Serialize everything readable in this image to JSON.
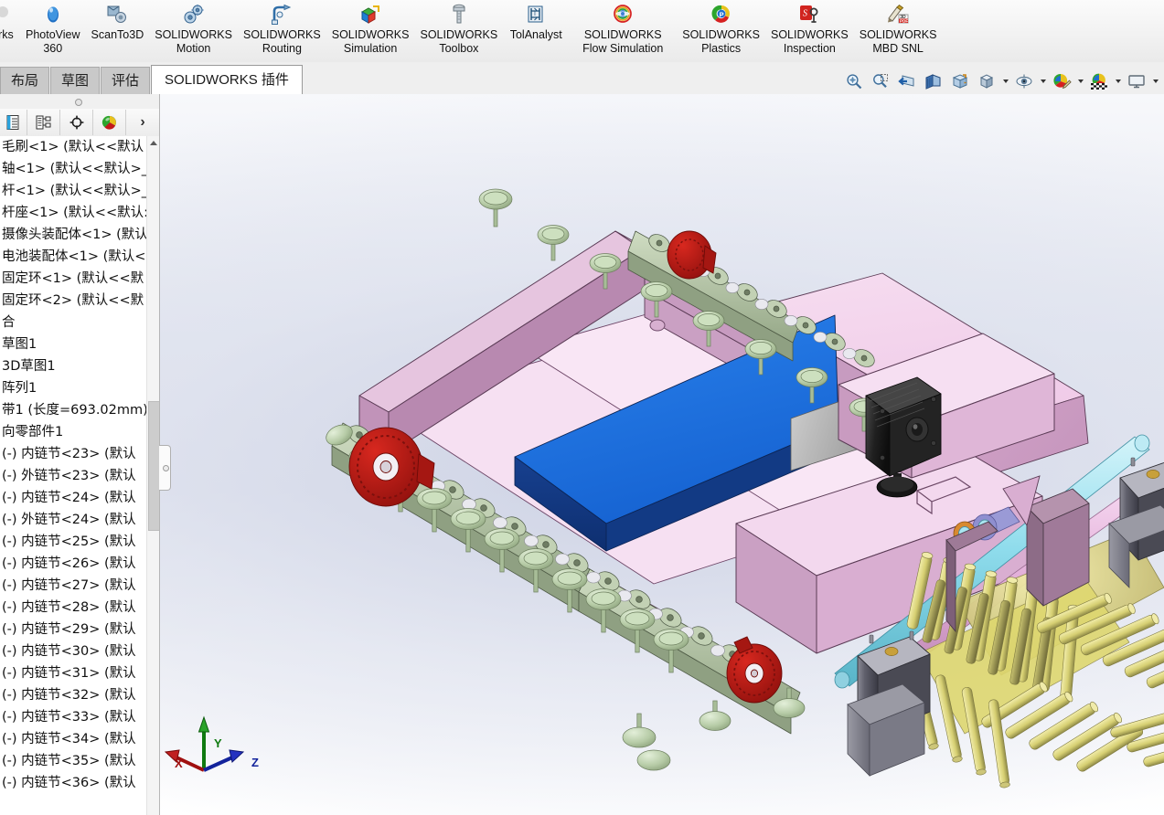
{
  "app": {
    "name": "SOLIDWORKS",
    "document_type": "assembly"
  },
  "ribbon": {
    "items": [
      {
        "label": "orks",
        "icon": "solidworks-partial-icon",
        "truncated": true
      },
      {
        "label": "PhotoView\n360",
        "icon": "photoview-360-icon"
      },
      {
        "label": "ScanTo3D",
        "icon": "scanto3d-icon"
      },
      {
        "label": "SOLIDWORKS\nMotion",
        "icon": "solidworks-motion-icon"
      },
      {
        "label": "SOLIDWORKS\nRouting",
        "icon": "solidworks-routing-icon"
      },
      {
        "label": "SOLIDWORKS\nSimulation",
        "icon": "solidworks-simulation-icon"
      },
      {
        "label": "SOLIDWORKS\nToolbox",
        "icon": "solidworks-toolbox-icon"
      },
      {
        "label": "TolAnalyst",
        "icon": "tolanalyst-icon"
      },
      {
        "label": "SOLIDWORKS\nFlow Simulation",
        "icon": "solidworks-flow-simulation-icon"
      },
      {
        "label": "SOLIDWORKS\nPlastics",
        "icon": "solidworks-plastics-icon"
      },
      {
        "label": "SOLIDWORKS\nInspection",
        "icon": "solidworks-inspection-icon"
      },
      {
        "label": "SOLIDWORKS\nMBD SNL",
        "icon": "solidworks-mbd-snl-icon"
      }
    ]
  },
  "feature_tabs": [
    {
      "label": "布局",
      "active": false,
      "name": "tab-layout"
    },
    {
      "label": "草图",
      "active": false,
      "name": "tab-sketch"
    },
    {
      "label": "评估",
      "active": false,
      "name": "tab-evaluate"
    },
    {
      "label": "SOLIDWORKS 插件",
      "active": true,
      "name": "tab-solidworks-addins"
    }
  ],
  "view_toolbar": [
    {
      "name": "zoom-to-fit-icon",
      "caret": false
    },
    {
      "name": "zoom-to-area-icon",
      "caret": false
    },
    {
      "name": "previous-view-icon",
      "caret": false
    },
    {
      "name": "section-view-icon",
      "caret": false
    },
    {
      "name": "view-orientation-icon",
      "caret": false
    },
    {
      "name": "display-style-icon",
      "caret": true
    },
    {
      "name": "hide-show-items-icon",
      "caret": true
    },
    {
      "name": "edit-appearance-icon",
      "caret": true
    },
    {
      "name": "apply-scene-icon",
      "caret": true
    },
    {
      "name": "view-settings-icon",
      "caret": true
    }
  ],
  "tree_toolbar": [
    {
      "name": "feature-manager-design-tree-icon"
    },
    {
      "name": "property-manager-icon"
    },
    {
      "name": "configuration-manager-icon"
    },
    {
      "name": "display-manager-icon"
    },
    {
      "name": "tree-expand-more-icon",
      "label": "›"
    }
  ],
  "feature_tree": {
    "scroll_position": "middle",
    "items": [
      {
        "label": "毛刷<1> (默认<<默认",
        "name": "tree-item-brush"
      },
      {
        "label": "轴<1> (默认<<默认>_",
        "name": "tree-item-shaft"
      },
      {
        "label": "杆<1> (默认<<默认>_",
        "name": "tree-item-rod"
      },
      {
        "label": "杆座<1> (默认<<默认:",
        "name": "tree-item-rod-seat"
      },
      {
        "label": "摄像头装配体<1> (默认",
        "name": "tree-item-camera-assembly"
      },
      {
        "label": "电池装配体<1> (默认<",
        "name": "tree-item-battery-assembly"
      },
      {
        "label": "固定环<1> (默认<<默",
        "name": "tree-item-retaining-ring-1"
      },
      {
        "label": "固定环<2> (默认<<默",
        "name": "tree-item-retaining-ring-2"
      },
      {
        "label": "合",
        "name": "tree-item-mates"
      },
      {
        "label": "草图1",
        "name": "tree-item-sketch1"
      },
      {
        "label": "3D草图1",
        "name": "tree-item-3dsketch1"
      },
      {
        "label": "阵列1",
        "name": "tree-item-pattern1"
      },
      {
        "label": "带1 (长度=693.02mm)",
        "name": "tree-item-belt1"
      },
      {
        "label": "向零部件1",
        "name": "tree-item-component1"
      },
      {
        "label": "(-) 内链节<23> (默认",
        "name": "tree-item-inner-link-23"
      },
      {
        "label": "(-) 外链节<23> (默认",
        "name": "tree-item-outer-link-23"
      },
      {
        "label": "(-) 内链节<24> (默认",
        "name": "tree-item-inner-link-24"
      },
      {
        "label": "(-) 外链节<24> (默认",
        "name": "tree-item-outer-link-24"
      },
      {
        "label": "(-) 内链节<25> (默认",
        "name": "tree-item-inner-link-25"
      },
      {
        "label": "(-) 内链节<26> (默认",
        "name": "tree-item-inner-link-26"
      },
      {
        "label": "(-) 内链节<27> (默认",
        "name": "tree-item-inner-link-27"
      },
      {
        "label": "(-) 内链节<28> (默认",
        "name": "tree-item-inner-link-28"
      },
      {
        "label": "(-) 内链节<29> (默认",
        "name": "tree-item-inner-link-29"
      },
      {
        "label": "(-) 内链节<30> (默认",
        "name": "tree-item-inner-link-30"
      },
      {
        "label": "(-) 内链节<31> (默认",
        "name": "tree-item-inner-link-31"
      },
      {
        "label": "(-) 内链节<32> (默认",
        "name": "tree-item-inner-link-32"
      },
      {
        "label": "(-) 内链节<33> (默认",
        "name": "tree-item-inner-link-33"
      },
      {
        "label": "(-) 内链节<34> (默认",
        "name": "tree-item-inner-link-34"
      },
      {
        "label": "(-) 内链节<35> (默认",
        "name": "tree-item-inner-link-35"
      },
      {
        "label": "(-) 内链节<36> (默认",
        "name": "tree-item-inner-link-36"
      }
    ]
  },
  "triad": {
    "x_label": "X",
    "y_label": "Y",
    "z_label": "Z",
    "x_color": "#a01010",
    "y_color": "#0f7a10",
    "z_color": "#13239c"
  },
  "model": {
    "description": "Tracked cleaning robot assembly - isometric shaded view with edges",
    "colors": {
      "chassis_pink": "#f2cfe8",
      "chassis_pink_dark": "#b98bb0",
      "chassis_pink_mid": "#d9a9d0",
      "battery_blue": "#1569e0",
      "battery_blue_dark": "#103e86",
      "track_green": "#b9cdaa",
      "track_green_dark": "#7d9070",
      "sprocket_red": "#b21212",
      "brush_yellow": "#e8e27a",
      "brush_yellow_dark": "#8d8a48",
      "motor_grey": "#575761",
      "camera_black": "#2b2b2b",
      "shaft_cyan": "#9fe3ef",
      "shaft_pink": "#e8b6dd",
      "collar_purple": "#8f8fd0",
      "collar_orange": "#dd8a33"
    }
  }
}
